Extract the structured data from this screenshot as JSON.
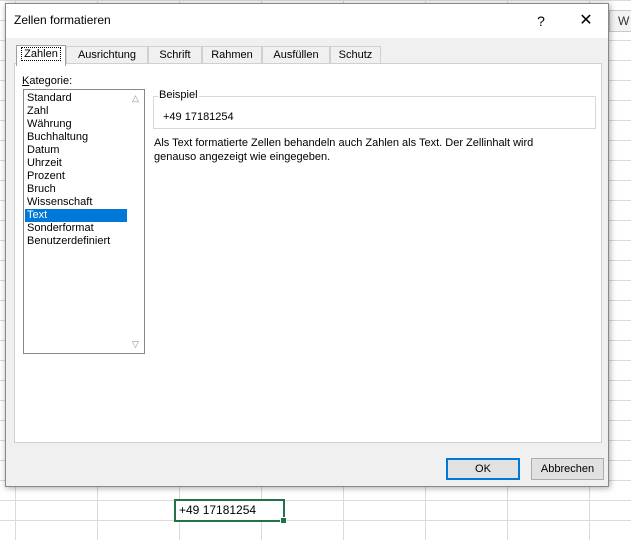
{
  "sheet": {
    "column_header": "W",
    "active_cell_value": "+49 17181254"
  },
  "dialog": {
    "title": "Zellen formatieren",
    "help_label": "?",
    "close_label": "✕",
    "tabs": [
      {
        "label": "Zahlen",
        "active": true
      },
      {
        "label": "Ausrichtung",
        "active": false
      },
      {
        "label": "Schrift",
        "active": false
      },
      {
        "label": "Rahmen",
        "active": false
      },
      {
        "label": "Ausfüllen",
        "active": false
      },
      {
        "label": "Schutz",
        "active": false
      }
    ],
    "category_label_underlined": "K",
    "category_label_rest": "ategorie:",
    "categories": [
      "Standard",
      "Zahl",
      "Währung",
      "Buchhaltung",
      "Datum",
      "Uhrzeit",
      "Prozent",
      "Bruch",
      "Wissenschaft",
      "Text",
      "Sonderformat",
      "Benutzerdefiniert"
    ],
    "selected_category": "Text",
    "sample_label": "Beispiel",
    "sample_value": "+49 17181254",
    "description": "Als Text formatierte Zellen behandeln auch Zahlen als Text. Der Zellinhalt wird genauso angezeigt wie eingegeben.",
    "ok_label": "OK",
    "cancel_label": "Abbrechen"
  },
  "colors": {
    "selection": "#0078d7",
    "cell_border": "#217346"
  }
}
